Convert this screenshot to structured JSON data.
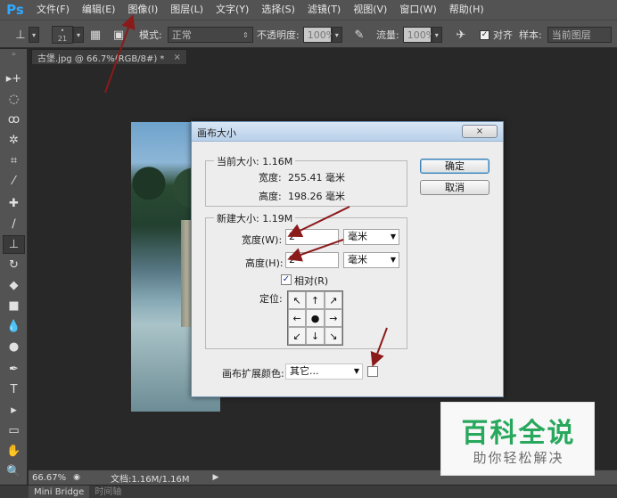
{
  "app": {
    "logo": "Ps"
  },
  "menu": [
    "文件(F)",
    "编辑(E)",
    "图像(I)",
    "图层(L)",
    "文字(Y)",
    "选择(S)",
    "滤镜(T)",
    "视图(V)",
    "窗口(W)",
    "帮助(H)"
  ],
  "options": {
    "brush_size": "21",
    "mode_label": "模式:",
    "mode_value": "正常",
    "opacity_label": "不透明度:",
    "opacity_value": "100%",
    "flow_label": "流量:",
    "flow_value": "100%",
    "aligned_label": "对齐",
    "aligned_checked": true,
    "sample_label": "样本:",
    "sample_value": "当前图层"
  },
  "document_tab": {
    "title": "古堡.jpg @ 66.7%(RGB/8#) *",
    "close": "×"
  },
  "dialog": {
    "title": "画布大小",
    "close": "×",
    "current_size": {
      "label": "当前大小: 1.16M",
      "width_label": "宽度:",
      "width_value": "255.41 毫米",
      "height_label": "高度:",
      "height_value": "198.26 毫米"
    },
    "new_size": {
      "label": "新建大小: 1.19M",
      "width_label": "宽度(W):",
      "width_value": "2",
      "width_unit": "毫米",
      "height_label": "高度(H):",
      "height_value": "2",
      "height_unit": "毫米",
      "relative_label": "相对(R)",
      "relative_checked": true,
      "anchor_label": "定位:",
      "anchor_arrows": [
        "↖",
        "↑",
        "↗",
        "←",
        "●",
        "→",
        "↙",
        "↓",
        "↘"
      ]
    },
    "extension_color_label": "画布扩展颜色:",
    "extension_color_value": "其它...",
    "ok_label": "确定",
    "cancel_label": "取消"
  },
  "status": {
    "zoom": "66.67%",
    "doc_info": "文档:1.16M/1.16M"
  },
  "bottom_tabs": [
    "Mini Bridge",
    "时间轴"
  ],
  "watermark": {
    "title": "百科全说",
    "subtitle": "助你轻松解决"
  },
  "colors": {
    "accent_logo": "#31a8ff",
    "annotation_arrow": "#8b1a1a",
    "watermark_green": "#27a85c"
  }
}
